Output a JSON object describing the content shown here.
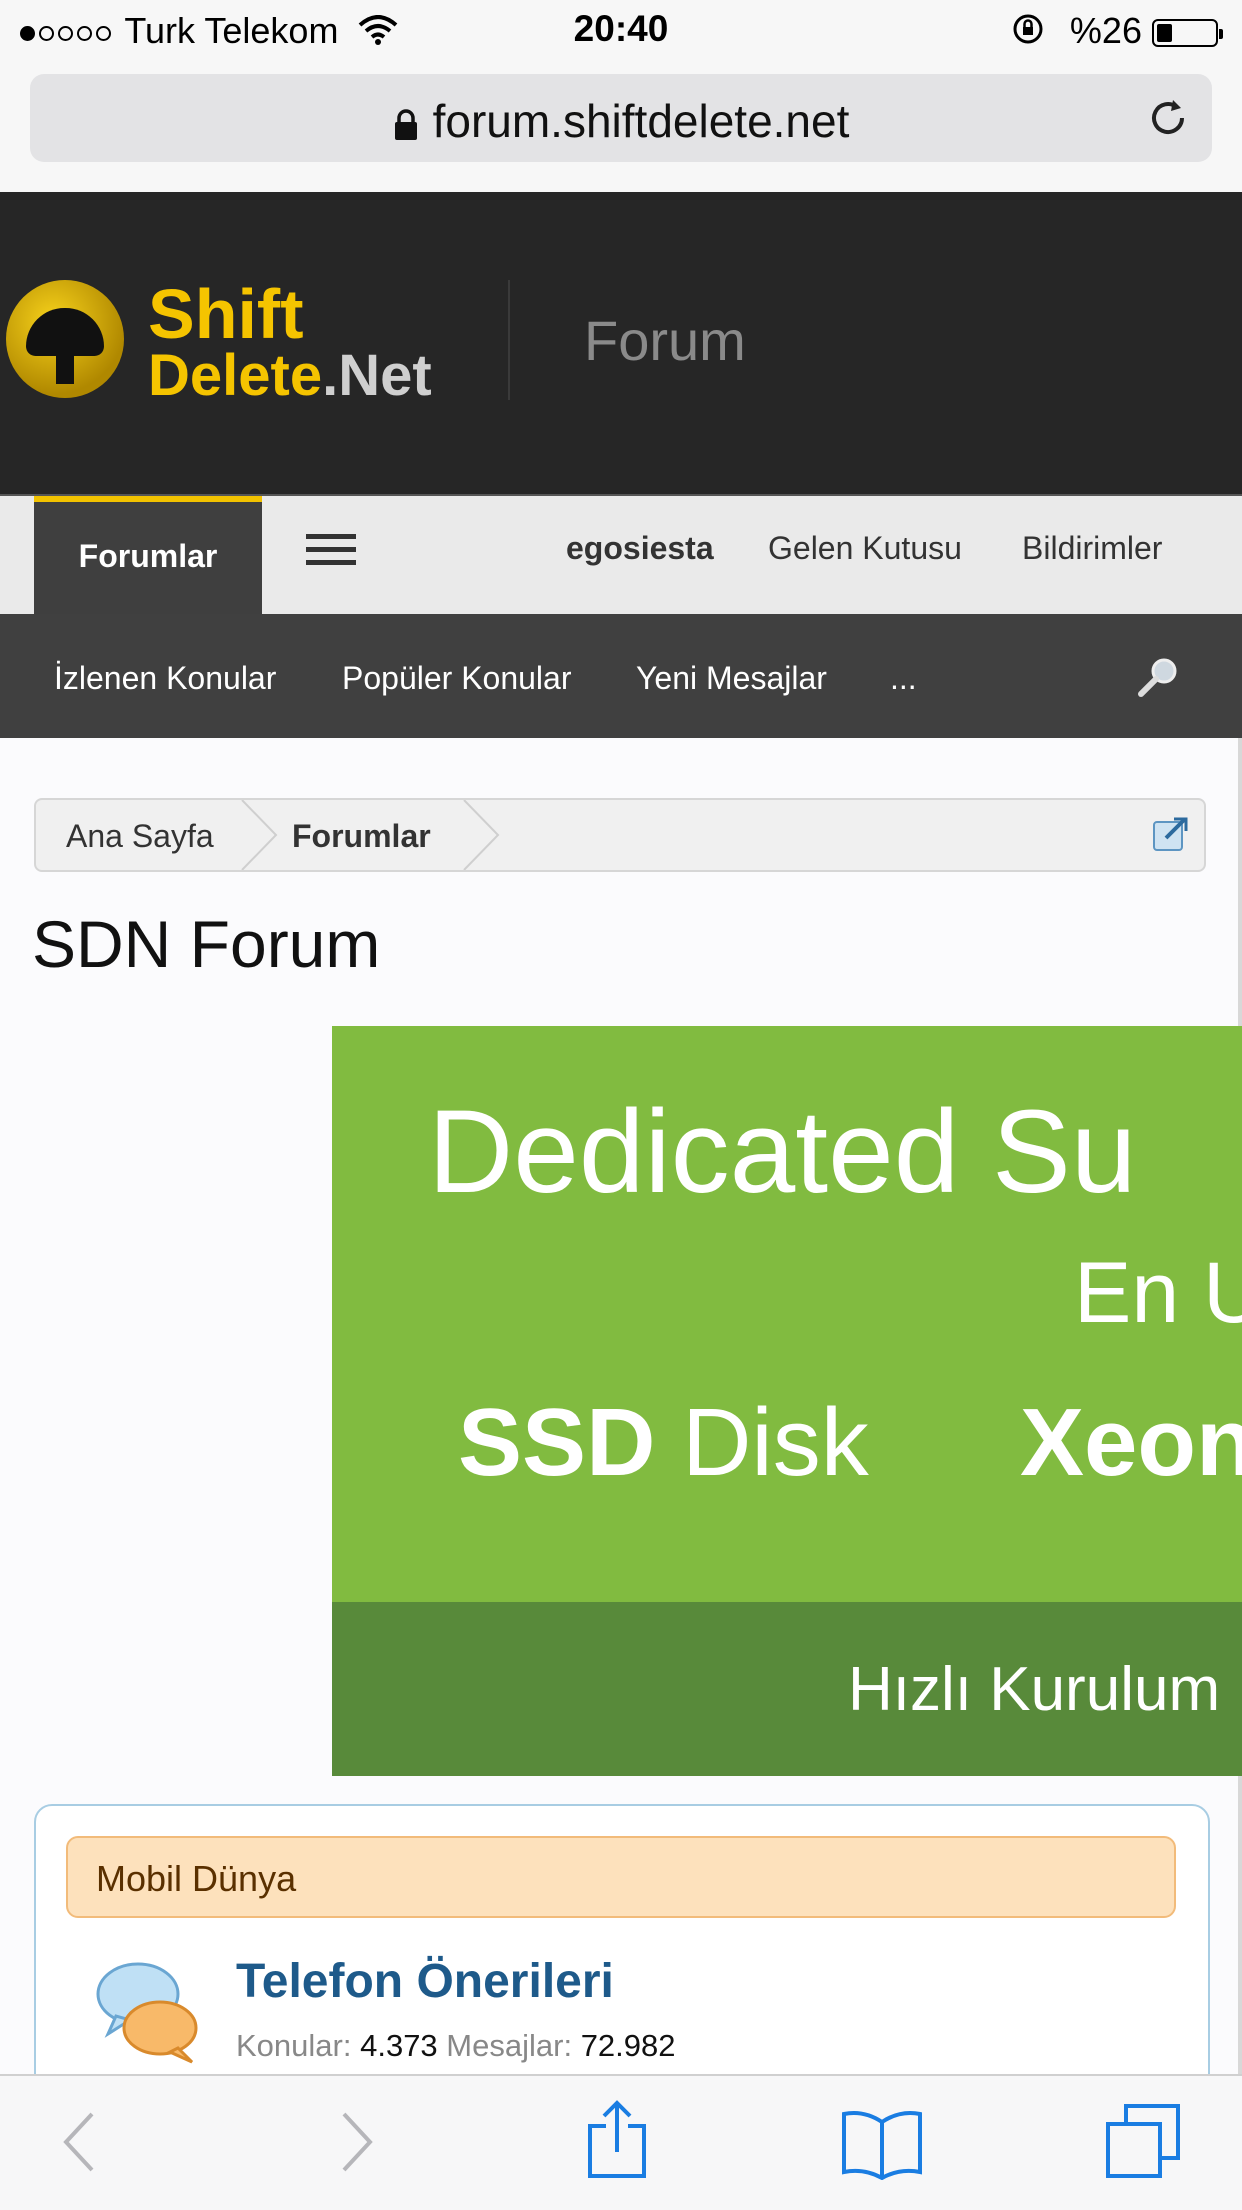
{
  "status_bar": {
    "carrier": "Turk Telekom",
    "time": "20:40",
    "battery": "%26",
    "battery_level": 0.26,
    "signal_bars": 1
  },
  "browser": {
    "url": "forum.shiftdelete.net"
  },
  "header": {
    "logo_line1": "Shift",
    "logo_line2_main": "Delete",
    "logo_line2_suffix": ".Net",
    "section": "Forum"
  },
  "nav": {
    "active_tab": "Forumlar",
    "user": "egosiesta",
    "inbox": "Gelen Kutusu",
    "alerts": "Bildirimler"
  },
  "subnav": {
    "items": [
      "İzlenen Konular",
      "Popüler Konular",
      "Yeni Mesajlar",
      "..."
    ]
  },
  "breadcrumb": {
    "items": [
      "Ana Sayfa",
      "Forumlar"
    ]
  },
  "page_title": "SDN Forum",
  "banner": {
    "line1": "Dedicated Su",
    "line2": "En U",
    "line3_bold": "SSD",
    "line3_rest": "Disk",
    "line3_right": "Xeon",
    "footer": "Hızlı Kurulum"
  },
  "forum": {
    "category": "Mobil Dünya",
    "title": "Telefon Önerileri",
    "threads_label": "Konular:",
    "threads": "4.373",
    "messages_label": "Mesajlar:",
    "messages": "72.982"
  },
  "toolbar": {
    "icons": [
      "back-icon",
      "forward-icon",
      "share-icon",
      "bookmarks-icon",
      "tabs-icon"
    ]
  }
}
